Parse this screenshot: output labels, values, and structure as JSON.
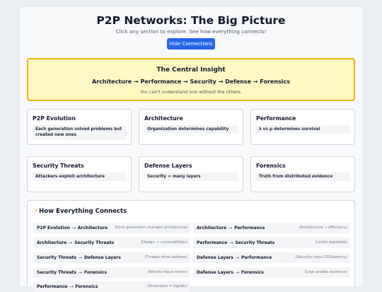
{
  "header": {
    "title": "P2P Networks: The Big Picture",
    "subtitle": "Click any section to explore. See how everything connects!",
    "toggle_label": "Hide Connections"
  },
  "insight": {
    "title": "The Central Insight",
    "chain": "Architecture → Performance → Security → Defense → Forensics",
    "note": "You can't understand one without the others."
  },
  "sections": [
    {
      "title": "P2P Evolution",
      "summary": "Each generation solved problems but created new ones"
    },
    {
      "title": "Architecture",
      "summary": "Organization determines capability"
    },
    {
      "title": "Performance",
      "summary": "λ vs μ determines survival"
    },
    {
      "title": "Security Threats",
      "summary": "Attackers exploit architecture"
    },
    {
      "title": "Defense Layers",
      "summary": "Security = many layers"
    },
    {
      "title": "Forensics",
      "summary": "Truth from distributed evidence"
    }
  ],
  "connections": {
    "title": "How Everything Connects",
    "icon": "lightning-icon",
    "arrow": "→",
    "items": [
      {
        "from": "P2P Evolution",
        "to": "Architecture",
        "note": "(Each generation changes architecture)"
      },
      {
        "from": "Architecture",
        "to": "Performance",
        "note": "(Architecture → efficiency)"
      },
      {
        "from": "Architecture",
        "to": "Security Threats",
        "note": "(Design → vulnerabilities)"
      },
      {
        "from": "Performance",
        "to": "Security Threats",
        "note": "(Limits exploited)"
      },
      {
        "from": "Security Threats",
        "to": "Defense Layers",
        "note": "(Threats drive defense)"
      },
      {
        "from": "Defense Layers",
        "to": "Performance",
        "note": "(Security costs CPU/latency)"
      },
      {
        "from": "Security Threats",
        "to": "Forensics",
        "note": "(Attacks leave traces)"
      },
      {
        "from": "Defense Layers",
        "to": "Forensics",
        "note": "(Logs enable evidence)"
      },
      {
        "from": "Performance",
        "to": "Forensics",
        "note": "(Anomalies = signals)"
      }
    ]
  }
}
